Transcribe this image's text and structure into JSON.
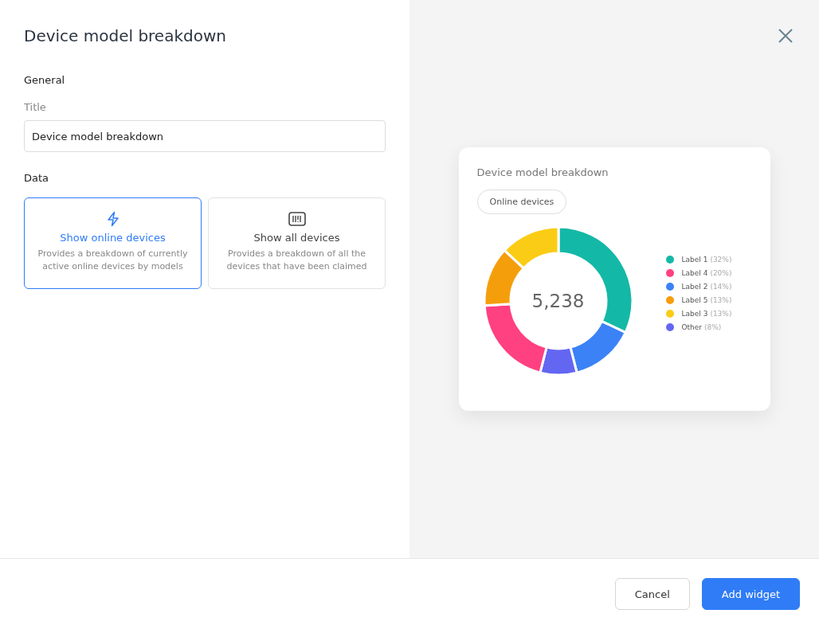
{
  "dialog": {
    "title": "Device model breakdown"
  },
  "form": {
    "section_general": "General",
    "title_label": "Title",
    "title_value": "Device model breakdown",
    "section_data": "Data",
    "options": [
      {
        "kind": "bolt",
        "label": "Show online devices",
        "description": "Provides a breakdown of currently active online devices by models",
        "selected": true
      },
      {
        "kind": "list",
        "label": "Show all devices",
        "description": "Provides a breakdown of all the devices that have been claimed",
        "selected": false
      }
    ]
  },
  "preview": {
    "title": "Device model breakdown",
    "chip": "Online devices",
    "total": "5,238",
    "chart_data": {
      "type": "donut",
      "values": [
        32,
        14,
        8,
        20,
        13,
        13
      ],
      "colors": [
        "#14b8a6",
        "#3b82f6",
        "#6366f1",
        "#ff4081",
        "#f59e0b",
        "#facc15"
      ]
    },
    "legend": [
      {
        "name": "Label 1",
        "share": "(32%)",
        "color": "#14b8a6"
      },
      {
        "name": "Label 4",
        "share": "(20%)",
        "color": "#ff4081"
      },
      {
        "name": "Label 2",
        "share": "(14%)",
        "color": "#3b82f6"
      },
      {
        "name": "Label 5",
        "share": "(13%)",
        "color": "#f59e0b"
      },
      {
        "name": "Label 3",
        "share": "(13%)",
        "color": "#facc15"
      },
      {
        "name": "Other",
        "share": "(8%)",
        "color": "#6366f1"
      }
    ]
  },
  "footer": {
    "buttons": [
      {
        "kind": "secondary",
        "label": "Cancel"
      },
      {
        "kind": "primary",
        "label": "Add widget"
      }
    ]
  }
}
